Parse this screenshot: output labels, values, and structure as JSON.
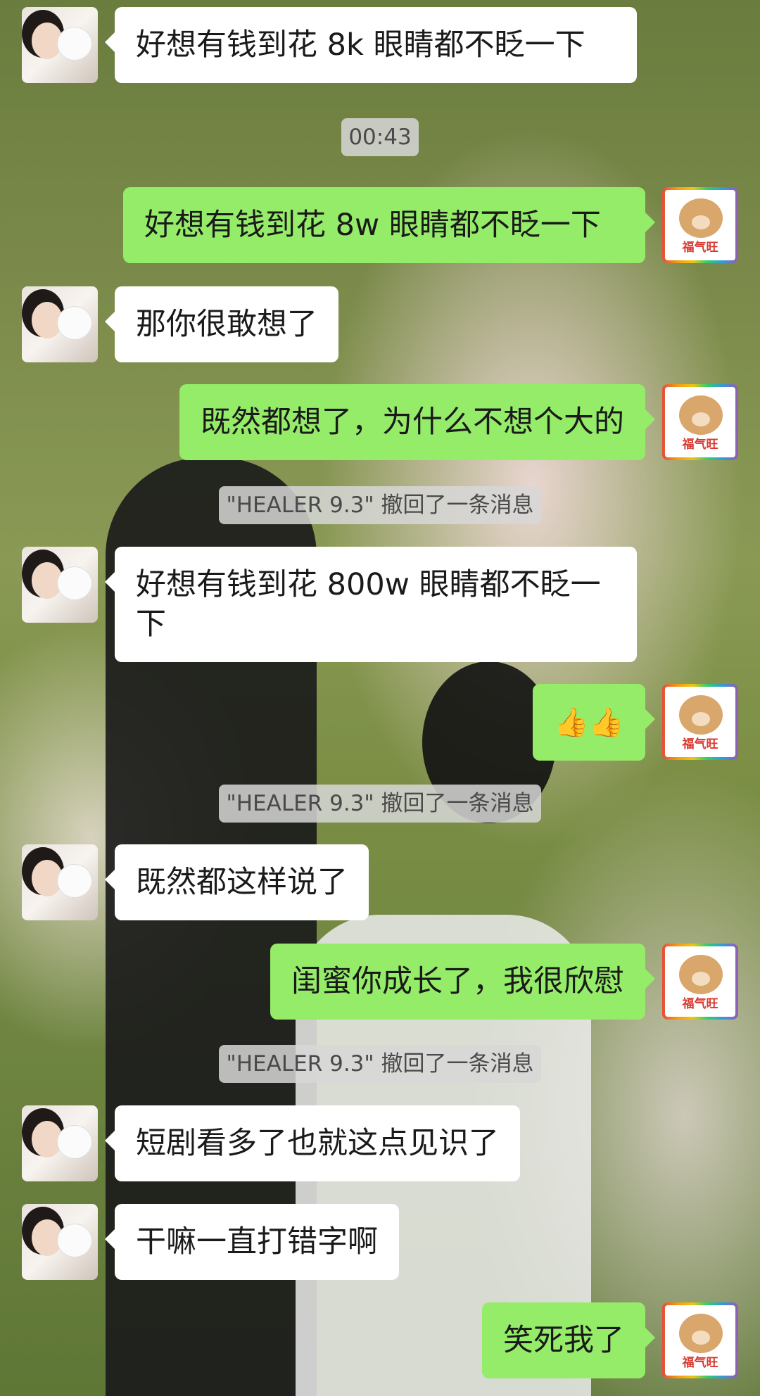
{
  "messages": [
    {
      "side": "left",
      "text": "好想有钱到花 8k 眼睛都不眨一下"
    },
    {
      "type": "time",
      "text": "00:43"
    },
    {
      "side": "right",
      "text": "好想有钱到花 8w 眼睛都不眨一下"
    },
    {
      "side": "left",
      "text": "那你很敢想了"
    },
    {
      "side": "right",
      "text": "既然都想了，为什么不想个大的"
    },
    {
      "type": "system",
      "text": "\"HEALER 9.3\" 撤回了一条消息"
    },
    {
      "side": "left",
      "text": "好想有钱到花 800w 眼睛都不眨一下"
    },
    {
      "side": "right",
      "text": "👍👍"
    },
    {
      "type": "system",
      "text": "\"HEALER 9.3\" 撤回了一条消息"
    },
    {
      "side": "left",
      "text": "既然都这样说了"
    },
    {
      "side": "right",
      "text": "闺蜜你成长了，我很欣慰"
    },
    {
      "type": "system",
      "text": "\"HEALER 9.3\" 撤回了一条消息"
    },
    {
      "side": "left",
      "text": "短剧看多了也就这点见识了"
    },
    {
      "side": "left",
      "text": "干嘛一直打错字啊"
    },
    {
      "side": "right",
      "text": "笑死我了"
    }
  ],
  "self_avatar_label": "福气旺",
  "colors": {
    "sent_bubble": "#95ec69",
    "received_bubble": "#ffffff",
    "system_bg": "#d7d7d7"
  }
}
